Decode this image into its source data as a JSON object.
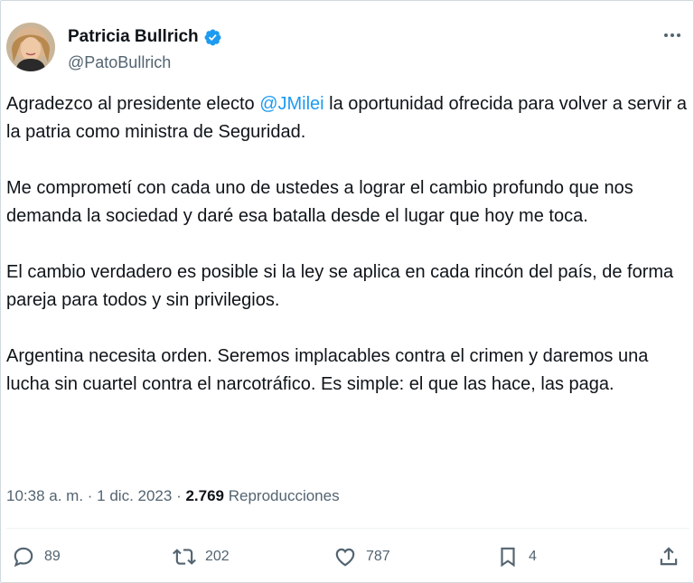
{
  "author": {
    "display_name": "Patricia Bullrich",
    "handle": "@PatoBullrich",
    "verified_icon": "verified-badge-icon",
    "avatar_icon": "profile-photo"
  },
  "more_icon": "more-options-icon",
  "tweet": {
    "p1_pre": "Agradezco al presidente electo ",
    "p1_mention": "@JMilei",
    "p1_post": " la oportunidad ofrecida para volver a servir a la patria como ministra de Seguridad.",
    "p2": "Me comprometí con cada uno de ustedes a lograr el cambio profundo que nos demanda la sociedad y daré esa batalla desde el lugar que hoy me toca.",
    "p3": "El cambio verdadero es posible si la ley se aplica en cada rincón del país, de forma pareja para todos y sin privilegios.",
    "p4": "Argentina necesita orden. Seremos implacables contra el crimen y daremos una lucha sin cuartel contra el narcotráfico. Es simple: el que las hace, las paga."
  },
  "meta": {
    "time": "10:38 a. m.",
    "sep1": " · ",
    "date": "1 dic. 2023",
    "sep2": " · ",
    "views_count": "2.769",
    "views_label": " Reproducciones"
  },
  "actions": {
    "replies": "89",
    "retweets": "202",
    "likes": "787",
    "bookmarks": "4"
  },
  "colors": {
    "accent": "#1d9bf0",
    "text": "#0f1419",
    "secondary": "#536471"
  }
}
